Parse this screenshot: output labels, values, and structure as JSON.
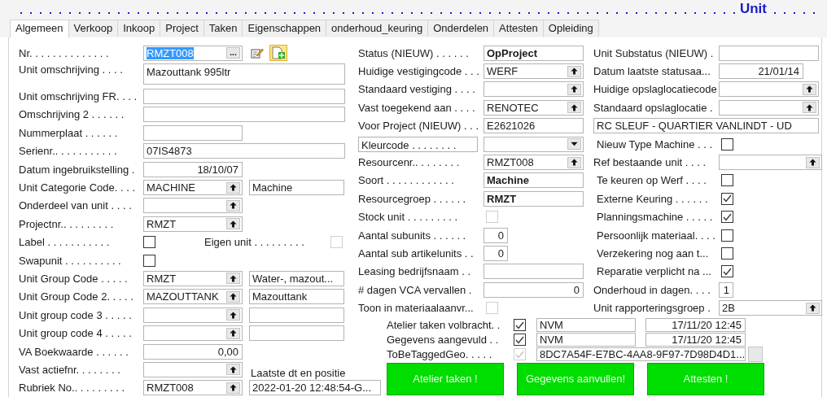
{
  "title": "Unit",
  "tabs": [
    {
      "label": "Algemeen",
      "selected": true
    },
    {
      "label": "Verkoop",
      "selected": false
    },
    {
      "label": "Inkoop",
      "selected": false
    },
    {
      "label": "Project",
      "selected": false
    },
    {
      "label": "Taken",
      "selected": false
    },
    {
      "label": "Eigenschappen",
      "selected": false
    },
    {
      "label": "onderhoud_keuring",
      "selected": false
    },
    {
      "label": "Onderdelen",
      "selected": false
    },
    {
      "label": "Attesten",
      "selected": false
    },
    {
      "label": "Opleiding",
      "selected": false
    }
  ],
  "left": [
    {
      "kind": "code",
      "label": "Nr. . . . . . . . . . . . . .",
      "value": "RMZT008",
      "highlighted": true,
      "button": "..."
    },
    {
      "kind": "memo",
      "label": "Unit omschrijving . . . .",
      "value": "Mazouttank 995ltr"
    },
    {
      "kind": "text",
      "label": "Unit omschrijving FR. . . ."
    },
    {
      "kind": "text",
      "label": "Omschrijving 2 . . . . . ."
    },
    {
      "kind": "short",
      "label": "Nummerplaat . . . . . ."
    },
    {
      "kind": "text",
      "label": "Serienr.. . . . . . . . . . .",
      "value": "07IS4873"
    },
    {
      "kind": "date",
      "label": "Datum ingebruikstelling .",
      "value": "18/10/07"
    },
    {
      "kind": "lookup_desc",
      "label": "Unit Categorie Code. . . .",
      "value": "MACHINE",
      "description": "Machine"
    },
    {
      "kind": "lookup",
      "label": "Onderdeel van unit . . . ."
    },
    {
      "kind": "lookup",
      "label": "Projectnr.. . . . . . . . .",
      "value": "RMZT"
    },
    {
      "kind": "checkbox_pair",
      "label": "Label . . . . . . . . . . .",
      "checked": false,
      "second_label": "Eigen unit . . . . . . . . .",
      "second_checked": false,
      "second_disabled": true
    },
    {
      "kind": "checkbox",
      "label": "Swapunit . . . . . . . . . .",
      "checked": false
    },
    {
      "kind": "lookup_desc",
      "label": "Unit Group Code . . . . .",
      "value": "RMZT",
      "description": "Water-, mazout..."
    },
    {
      "kind": "lookup_desc",
      "label": "Unit Group Code 2. . . . .",
      "value": "MAZOUTTANK",
      "description": "Mazouttank"
    },
    {
      "kind": "lookup_desc",
      "label": "Unit group code 3 . . . . ."
    },
    {
      "kind": "lookup_desc",
      "label": "Unit group code 4 . . . . ."
    },
    {
      "kind": "number",
      "label": "VA Boekwaarde . . . . . .",
      "value": "0,00"
    },
    {
      "kind": "lookup",
      "label": "Vast actiefnr. . . . . . . .",
      "side_label": "Laatste dt en positie"
    },
    {
      "kind": "lookup_long",
      "label": "Rubriek No.. . . . . . . . .",
      "value": "RMZT008",
      "description": "2022-01-20 12:48:54-G..."
    }
  ],
  "middle": [
    {
      "kind": "flow",
      "label": "Status (NIEUW) . . . . . .",
      "value": "OpProject"
    },
    {
      "kind": "lookup",
      "label": "Huidige vestigingcode . . .",
      "value": "WERF"
    },
    {
      "kind": "lookup",
      "label": "Standaard vestiging . . . ."
    },
    {
      "kind": "lookup",
      "label": "Vast toegekend aan . . . .",
      "value": "RENOTEC"
    },
    {
      "kind": "text",
      "label": "Voor Project (NIEUW) . . .",
      "value": "E2621026"
    },
    {
      "kind": "option",
      "label": "Kleurcode . . . . . . . ."
    },
    {
      "kind": "lookup",
      "label": "Resourcenr.. . . . . . . .",
      "value": "RMZT008"
    },
    {
      "kind": "flow",
      "label": "Soort . . . . . . . . . . . .",
      "value": "Machine"
    },
    {
      "kind": "flow",
      "label": "Resourcegroep . . . . . .",
      "value": "RMZT"
    },
    {
      "kind": "checkbox",
      "label": "Stock unit . . . . . . . . .",
      "checked": false,
      "disabled": true
    },
    {
      "kind": "tiny",
      "label": "Aantal subunits . . . . . .",
      "value": "0"
    },
    {
      "kind": "tiny",
      "label": "Aantal sub artikelunits . .",
      "value": "0"
    },
    {
      "kind": "text",
      "label": "Leasing bedrijfsnaam . ."
    },
    {
      "kind": "number",
      "label": "# dagen VCA vervallen .",
      "value": "0"
    },
    {
      "kind": "checkbox",
      "label": "Toon in materiaalaanvr...",
      "checked": false,
      "disabled": true
    }
  ],
  "right": [
    {
      "kind": "text",
      "label": "Unit Substatus (NIEUW) ."
    },
    {
      "kind": "date",
      "label": "Datum laatste statusaa...",
      "value": "21/01/14"
    },
    {
      "kind": "lookup",
      "label": "Huidige opslaglocatiecode"
    },
    {
      "kind": "lookup",
      "label": "Standaard opslaglocatie ."
    },
    {
      "kind": "wide",
      "value": "RC SLEUF - QUARTIER VANLINDT - UD"
    },
    {
      "kind": "checkbox",
      "label": "Nieuw Type Machine . . .",
      "checked": false
    },
    {
      "kind": "lookup",
      "label": "Ref bestaande unit . . . ."
    },
    {
      "kind": "checkbox",
      "label": "Te keuren op Werf . . . .",
      "checked": false
    },
    {
      "kind": "checkbox",
      "label": "Externe Keuring . . . . . .",
      "checked": true
    },
    {
      "kind": "checkbox",
      "label": "Planningsmachine . . . . .",
      "checked": true
    },
    {
      "kind": "checkbox",
      "label": "Persoonlijk materiaal. . . .",
      "checked": false
    },
    {
      "kind": "checkbox",
      "label": "Verzekering nog aan t...",
      "checked": false
    },
    {
      "kind": "checkbox",
      "label": "Reparatie verplicht na ...",
      "checked": true
    },
    {
      "kind": "digit",
      "label": "Onderhoud in dagen. . . .",
      "value": "1"
    },
    {
      "kind": "lookup",
      "label": "Unit rapporteringsgroep .",
      "value": "2B"
    }
  ],
  "approvals": [
    {
      "kind": "signed",
      "label": "Atelier taken volbracht. .",
      "checked": true,
      "user": "NVM",
      "datetime": "17/11/20 12:45"
    },
    {
      "kind": "signed",
      "label": "Gegevens aangevuld . .",
      "checked": true,
      "user": "NVM",
      "datetime": "17/11/20 12:45"
    },
    {
      "kind": "guid",
      "label": "ToBeTaggedGeo. . . . .",
      "checked": true,
      "disabled": true,
      "value": "8DC7A54F-E7BC-4AA8-9F97-7D98D4D1..."
    }
  ],
  "buttons": [
    "Atelier taken !",
    "Gegevens aanvullen!",
    "Attesten !"
  ]
}
